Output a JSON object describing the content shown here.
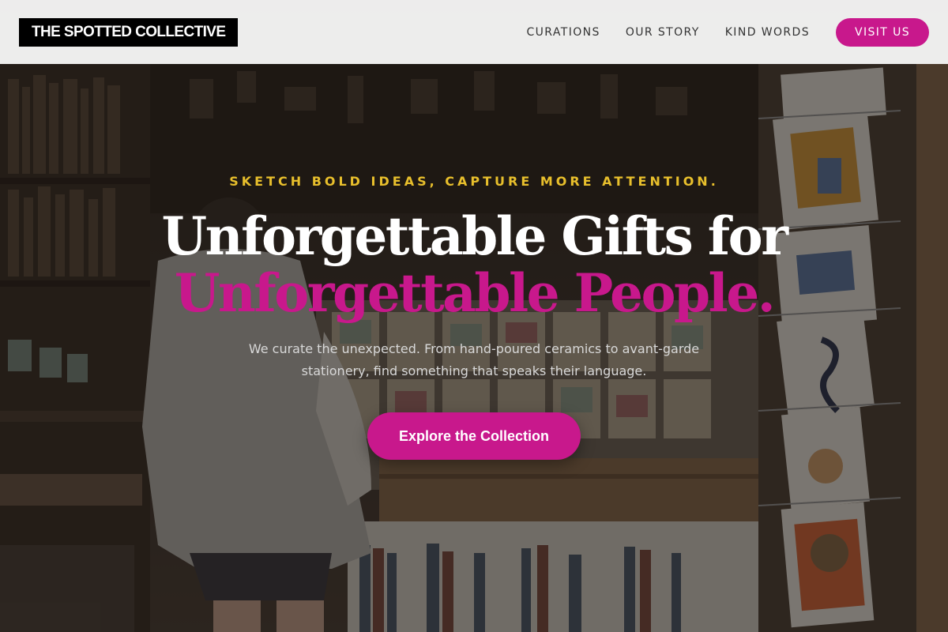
{
  "nav": {
    "brand": "THE SPOTTED COLLECTIVE",
    "links": [
      "CURATIONS",
      "OUR STORY",
      "KIND WORDS"
    ],
    "visit_label": "VISIT US"
  },
  "hero": {
    "tagline": "SKETCH BOLD IDEAS, CAPTURE MORE ATTENTION.",
    "headline_line1": "Unforgettable Gifts for",
    "headline_line2": "Unforgettable People.",
    "subtext": "We curate the unexpected. From hand-poured ceramics to avant-garde stationery, find something that speaks their language.",
    "cta_label": "Explore the Collection"
  },
  "colors": {
    "accent": "#c8188c",
    "tagline": "#e8bf2c",
    "brand_bg": "#000000",
    "nav_bg": "#f6f6f6"
  }
}
